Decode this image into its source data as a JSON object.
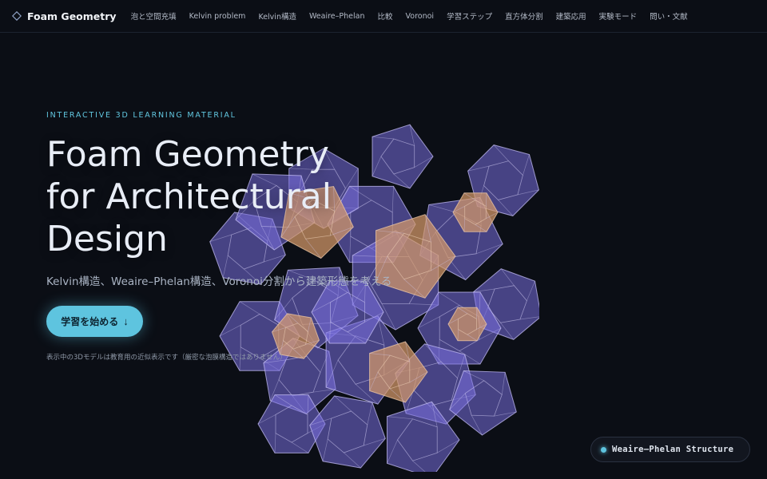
{
  "nav": {
    "brand": "Foam Geometry",
    "brand_icon": "diamond-outline-icon",
    "items": [
      "泡と空間充填",
      "Kelvin problem",
      "Kelvin構造",
      "Weaire–Phelan",
      "比較",
      "Voronoi",
      "学習ステップ",
      "直方体分割",
      "建築応用",
      "実験モード",
      "問い・文献"
    ]
  },
  "hero": {
    "eyebrow": "INTERACTIVE 3D LEARNING MATERIAL",
    "title_lines": [
      "Foam Geometry",
      "for Architectural",
      "Design"
    ],
    "subtitle": "Kelvin構造、Weaire–Phelan構造、Voronoi分割から建築形態を考える",
    "cta_label": "学習を始める",
    "cta_arrow": "↓",
    "note": "表示中の3Dモデルは教育用の近似表示です（厳密な泡膜構造ではありません）"
  },
  "badge": {
    "label": "Weaire–Phelan Structure"
  },
  "colors": {
    "accent": "#5ec4df",
    "background": "#0b0e15",
    "cell_violet": "#7a6fe0",
    "cell_orange": "#d59a6a"
  }
}
